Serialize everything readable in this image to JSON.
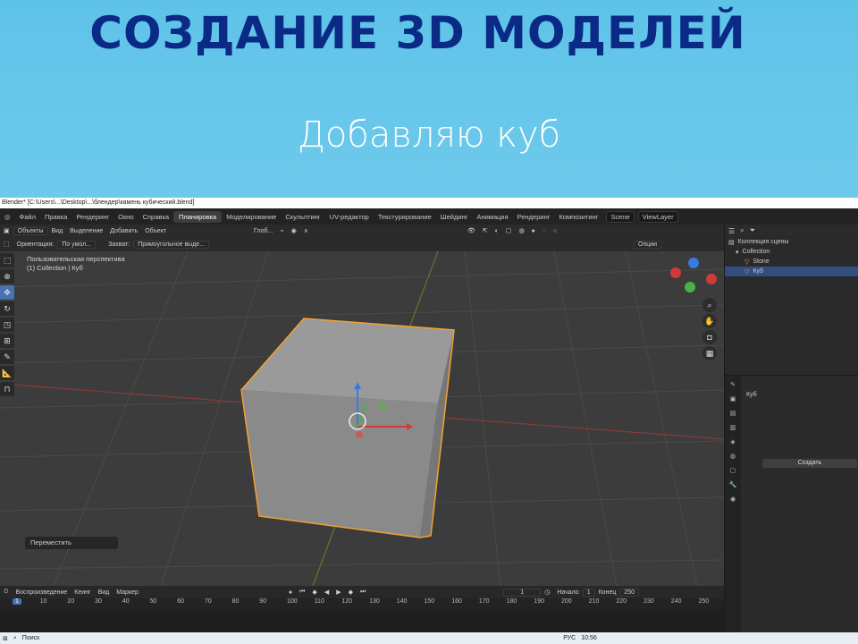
{
  "slide": {
    "title": "СОЗДАНИЕ 3D МОДЕЛЕЙ",
    "subtitle": "Добавляю куб"
  },
  "window": {
    "title": "Blender* [C:\\Users\\...\\Desktop\\...\\блендер\\камень кубический.blend]"
  },
  "menu": {
    "items": [
      "Файл",
      "Правка",
      "Рендеринг",
      "Окно",
      "Справка"
    ],
    "workspaces": [
      "Планировка",
      "Моделирование",
      "Скульптинг",
      "UV-редактор",
      "Текстурирование",
      "Шейдинг",
      "Анимация",
      "Рендеринг",
      "Композитинг"
    ],
    "active_workspace": "Планировка",
    "scene": "Scene",
    "view_layer": "ViewLayer"
  },
  "header": {
    "mode": "Объекты",
    "view": "Вид",
    "select": "Выделение",
    "add": "Добавить",
    "object": "Объект",
    "orientation_label": "Ориентация:",
    "orientation_value": "По умол...",
    "snap_label": "Захват:",
    "snap_value": "Прямоугольное выде...",
    "transform_space": "Глоб...",
    "options": "Опции"
  },
  "viewport": {
    "perspective": "Пользовательская перспектива",
    "context": "(1) Collection | Куб",
    "last_op": "Переместить"
  },
  "timeline": {
    "playback": "Воспроизведение",
    "keying": "Кеинг",
    "view": "Вид",
    "marker": "Маркер",
    "current_frame": "1",
    "start_label": "Начало",
    "start": "1",
    "end_label": "Конец",
    "end": "250",
    "ticks": [
      "1",
      "10",
      "20",
      "30",
      "40",
      "50",
      "60",
      "70",
      "80",
      "90",
      "100",
      "110",
      "120",
      "130",
      "140",
      "150",
      "160",
      "170",
      "180",
      "190",
      "200",
      "210",
      "220",
      "230",
      "240",
      "250"
    ]
  },
  "outliner": {
    "root": "Коллекция сцены",
    "collection": "Collection",
    "items": [
      "Stone",
      "Куб"
    ]
  },
  "properties": {
    "object": "Куб",
    "create": "Создать"
  },
  "taskbar": {
    "search": "Поиск",
    "lang": "РУС",
    "time": "10:56"
  },
  "colors": {
    "title": "#0a2a86",
    "accent": "#4772b3",
    "selection": "#f5a030"
  }
}
